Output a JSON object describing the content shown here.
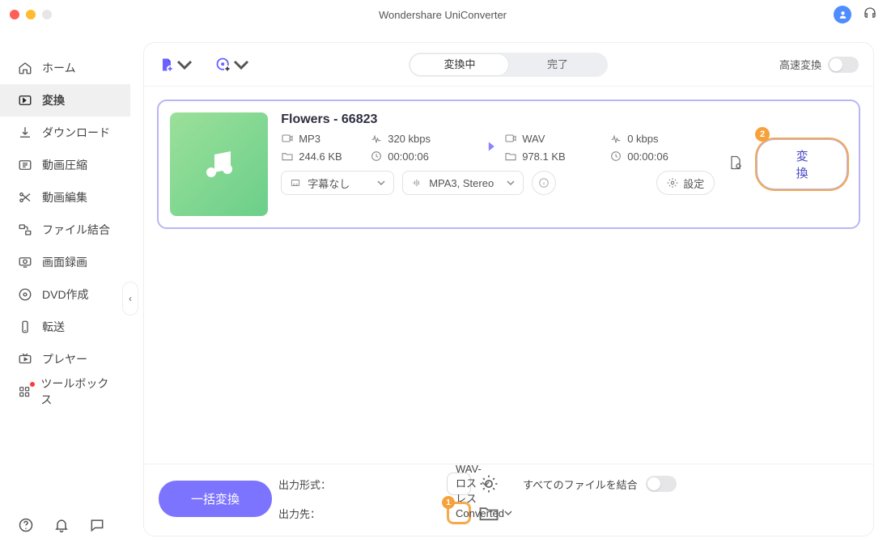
{
  "app_title": "Wondershare UniConverter",
  "sidebar": {
    "items": [
      {
        "label": "ホーム"
      },
      {
        "label": "変換"
      },
      {
        "label": "ダウンロード"
      },
      {
        "label": "動画圧縮"
      },
      {
        "label": "動画編集"
      },
      {
        "label": "ファイル結合"
      },
      {
        "label": "画面録画"
      },
      {
        "label": "DVD作成"
      },
      {
        "label": "転送"
      },
      {
        "label": "プレヤー"
      },
      {
        "label": "ツールボックス"
      }
    ]
  },
  "tabs": {
    "converting": "変換中",
    "done": "完了"
  },
  "high_speed_label": "高速変換",
  "file": {
    "title": "Flowers - 66823",
    "src": {
      "format": "MP3",
      "bitrate": "320 kbps",
      "size": "244.6 KB",
      "duration": "00:00:06"
    },
    "dst": {
      "format": "WAV",
      "bitrate": "0 kbps",
      "size": "978.1 KB",
      "duration": "00:00:06"
    },
    "subtitle_label": "字幕なし",
    "audio_label": "MPA3, Stereo",
    "settings_label": "設定",
    "convert_label": "変換"
  },
  "footer": {
    "format_label": "出力形式：",
    "format_value": "WAV-ロスレス",
    "dest_label": "出力先：",
    "dest_value": "Converted",
    "merge_label": "すべてのファイルを結合",
    "batch_label": "一括変換"
  },
  "annotations": {
    "one": "1",
    "two": "2"
  }
}
